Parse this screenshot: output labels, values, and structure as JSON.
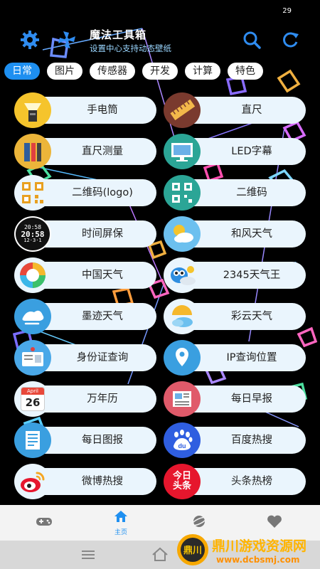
{
  "status_bar": {
    "time": "29"
  },
  "header": {
    "title": "魔法工具箱",
    "subtitle": "设置中心支持动态壁纸"
  },
  "tabs": [
    {
      "label": "日常",
      "active": true
    },
    {
      "label": "图片",
      "active": false
    },
    {
      "label": "传感器",
      "active": false
    },
    {
      "label": "开发",
      "active": false
    },
    {
      "label": "计算",
      "active": false
    },
    {
      "label": "特色",
      "active": false
    }
  ],
  "tools": [
    {
      "label": "手电筒",
      "icon": "flashlight-icon"
    },
    {
      "label": "直尺",
      "icon": "ruler-icon"
    },
    {
      "label": "直尺测量",
      "icon": "ruler-measure-icon"
    },
    {
      "label": "LED字幕",
      "icon": "led-monitor-icon"
    },
    {
      "label": "二维码(logo)",
      "icon": "qrcode-logo-icon"
    },
    {
      "label": "二维码",
      "icon": "qrcode-icon"
    },
    {
      "label": "时间屏保",
      "icon": "clock-screensaver-icon",
      "clock": [
        "20:58",
        "20:58",
        "12·3·1"
      ]
    },
    {
      "label": "和风天气",
      "icon": "sun-cloud-icon"
    },
    {
      "label": "中国天气",
      "icon": "china-weather-icon"
    },
    {
      "label": "2345天气王",
      "icon": "bird-weather-icon"
    },
    {
      "label": "墨迹天气",
      "icon": "cloud-wind-icon"
    },
    {
      "label": "彩云天气",
      "icon": "umbrella-cloud-icon"
    },
    {
      "label": "身份证查询",
      "icon": "id-card-icon"
    },
    {
      "label": "IP查询位置",
      "icon": "location-pin-icon"
    },
    {
      "label": "万年历",
      "icon": "calendar-icon",
      "calendar": [
        "April",
        "26"
      ]
    },
    {
      "label": "每日早报",
      "icon": "newspaper-icon"
    },
    {
      "label": "每日图报",
      "icon": "document-icon"
    },
    {
      "label": "百度热搜",
      "icon": "baidu-icon",
      "logo_text": "du"
    },
    {
      "label": "微博热搜",
      "icon": "weibo-icon"
    },
    {
      "label": "头条热榜",
      "icon": "toutiao-icon",
      "logo_text": "今日头条"
    }
  ],
  "bottom_nav": [
    {
      "label": "",
      "icon": "gamepad-icon"
    },
    {
      "label": "主页",
      "icon": "home-icon",
      "active": true
    },
    {
      "label": "",
      "icon": "planet-icon"
    },
    {
      "label": "",
      "icon": "heart-icon"
    }
  ],
  "watermark": {
    "title": "鼎川游戏资源网",
    "url": "www.dcbsmj.com",
    "logo_text": "鼎川"
  },
  "colors": {
    "accent": "#1e8ff0",
    "item_bg": "#eaf5fd",
    "background": "#000000"
  }
}
